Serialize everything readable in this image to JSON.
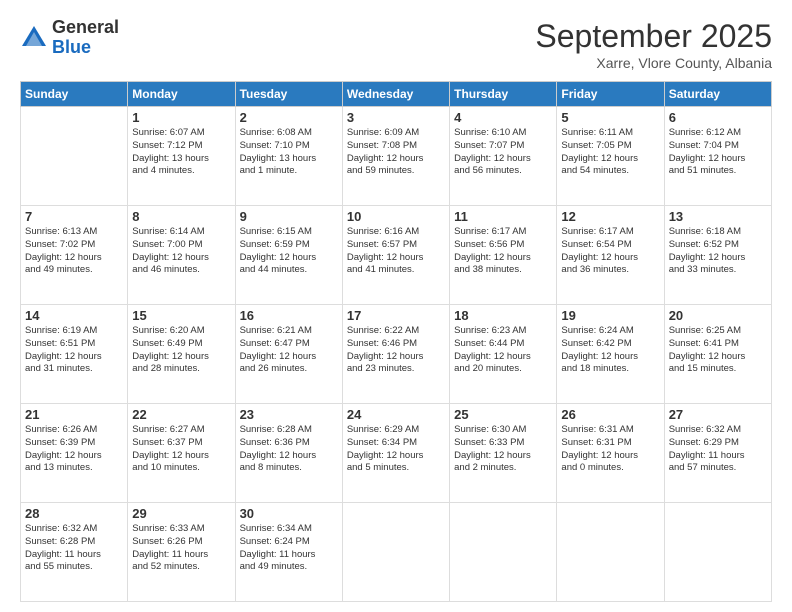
{
  "logo": {
    "general": "General",
    "blue": "Blue"
  },
  "header": {
    "month": "September 2025",
    "location": "Xarre, Vlore County, Albania"
  },
  "days": [
    "Sunday",
    "Monday",
    "Tuesday",
    "Wednesday",
    "Thursday",
    "Friday",
    "Saturday"
  ],
  "weeks": [
    [
      {
        "day": "",
        "lines": []
      },
      {
        "day": "1",
        "lines": [
          "Sunrise: 6:07 AM",
          "Sunset: 7:12 PM",
          "Daylight: 13 hours",
          "and 4 minutes."
        ]
      },
      {
        "day": "2",
        "lines": [
          "Sunrise: 6:08 AM",
          "Sunset: 7:10 PM",
          "Daylight: 13 hours",
          "and 1 minute."
        ]
      },
      {
        "day": "3",
        "lines": [
          "Sunrise: 6:09 AM",
          "Sunset: 7:08 PM",
          "Daylight: 12 hours",
          "and 59 minutes."
        ]
      },
      {
        "day": "4",
        "lines": [
          "Sunrise: 6:10 AM",
          "Sunset: 7:07 PM",
          "Daylight: 12 hours",
          "and 56 minutes."
        ]
      },
      {
        "day": "5",
        "lines": [
          "Sunrise: 6:11 AM",
          "Sunset: 7:05 PM",
          "Daylight: 12 hours",
          "and 54 minutes."
        ]
      },
      {
        "day": "6",
        "lines": [
          "Sunrise: 6:12 AM",
          "Sunset: 7:04 PM",
          "Daylight: 12 hours",
          "and 51 minutes."
        ]
      }
    ],
    [
      {
        "day": "7",
        "lines": [
          "Sunrise: 6:13 AM",
          "Sunset: 7:02 PM",
          "Daylight: 12 hours",
          "and 49 minutes."
        ]
      },
      {
        "day": "8",
        "lines": [
          "Sunrise: 6:14 AM",
          "Sunset: 7:00 PM",
          "Daylight: 12 hours",
          "and 46 minutes."
        ]
      },
      {
        "day": "9",
        "lines": [
          "Sunrise: 6:15 AM",
          "Sunset: 6:59 PM",
          "Daylight: 12 hours",
          "and 44 minutes."
        ]
      },
      {
        "day": "10",
        "lines": [
          "Sunrise: 6:16 AM",
          "Sunset: 6:57 PM",
          "Daylight: 12 hours",
          "and 41 minutes."
        ]
      },
      {
        "day": "11",
        "lines": [
          "Sunrise: 6:17 AM",
          "Sunset: 6:56 PM",
          "Daylight: 12 hours",
          "and 38 minutes."
        ]
      },
      {
        "day": "12",
        "lines": [
          "Sunrise: 6:17 AM",
          "Sunset: 6:54 PM",
          "Daylight: 12 hours",
          "and 36 minutes."
        ]
      },
      {
        "day": "13",
        "lines": [
          "Sunrise: 6:18 AM",
          "Sunset: 6:52 PM",
          "Daylight: 12 hours",
          "and 33 minutes."
        ]
      }
    ],
    [
      {
        "day": "14",
        "lines": [
          "Sunrise: 6:19 AM",
          "Sunset: 6:51 PM",
          "Daylight: 12 hours",
          "and 31 minutes."
        ]
      },
      {
        "day": "15",
        "lines": [
          "Sunrise: 6:20 AM",
          "Sunset: 6:49 PM",
          "Daylight: 12 hours",
          "and 28 minutes."
        ]
      },
      {
        "day": "16",
        "lines": [
          "Sunrise: 6:21 AM",
          "Sunset: 6:47 PM",
          "Daylight: 12 hours",
          "and 26 minutes."
        ]
      },
      {
        "day": "17",
        "lines": [
          "Sunrise: 6:22 AM",
          "Sunset: 6:46 PM",
          "Daylight: 12 hours",
          "and 23 minutes."
        ]
      },
      {
        "day": "18",
        "lines": [
          "Sunrise: 6:23 AM",
          "Sunset: 6:44 PM",
          "Daylight: 12 hours",
          "and 20 minutes."
        ]
      },
      {
        "day": "19",
        "lines": [
          "Sunrise: 6:24 AM",
          "Sunset: 6:42 PM",
          "Daylight: 12 hours",
          "and 18 minutes."
        ]
      },
      {
        "day": "20",
        "lines": [
          "Sunrise: 6:25 AM",
          "Sunset: 6:41 PM",
          "Daylight: 12 hours",
          "and 15 minutes."
        ]
      }
    ],
    [
      {
        "day": "21",
        "lines": [
          "Sunrise: 6:26 AM",
          "Sunset: 6:39 PM",
          "Daylight: 12 hours",
          "and 13 minutes."
        ]
      },
      {
        "day": "22",
        "lines": [
          "Sunrise: 6:27 AM",
          "Sunset: 6:37 PM",
          "Daylight: 12 hours",
          "and 10 minutes."
        ]
      },
      {
        "day": "23",
        "lines": [
          "Sunrise: 6:28 AM",
          "Sunset: 6:36 PM",
          "Daylight: 12 hours",
          "and 8 minutes."
        ]
      },
      {
        "day": "24",
        "lines": [
          "Sunrise: 6:29 AM",
          "Sunset: 6:34 PM",
          "Daylight: 12 hours",
          "and 5 minutes."
        ]
      },
      {
        "day": "25",
        "lines": [
          "Sunrise: 6:30 AM",
          "Sunset: 6:33 PM",
          "Daylight: 12 hours",
          "and 2 minutes."
        ]
      },
      {
        "day": "26",
        "lines": [
          "Sunrise: 6:31 AM",
          "Sunset: 6:31 PM",
          "Daylight: 12 hours",
          "and 0 minutes."
        ]
      },
      {
        "day": "27",
        "lines": [
          "Sunrise: 6:32 AM",
          "Sunset: 6:29 PM",
          "Daylight: 11 hours",
          "and 57 minutes."
        ]
      }
    ],
    [
      {
        "day": "28",
        "lines": [
          "Sunrise: 6:32 AM",
          "Sunset: 6:28 PM",
          "Daylight: 11 hours",
          "and 55 minutes."
        ]
      },
      {
        "day": "29",
        "lines": [
          "Sunrise: 6:33 AM",
          "Sunset: 6:26 PM",
          "Daylight: 11 hours",
          "and 52 minutes."
        ]
      },
      {
        "day": "30",
        "lines": [
          "Sunrise: 6:34 AM",
          "Sunset: 6:24 PM",
          "Daylight: 11 hours",
          "and 49 minutes."
        ]
      },
      {
        "day": "",
        "lines": []
      },
      {
        "day": "",
        "lines": []
      },
      {
        "day": "",
        "lines": []
      },
      {
        "day": "",
        "lines": []
      }
    ]
  ]
}
